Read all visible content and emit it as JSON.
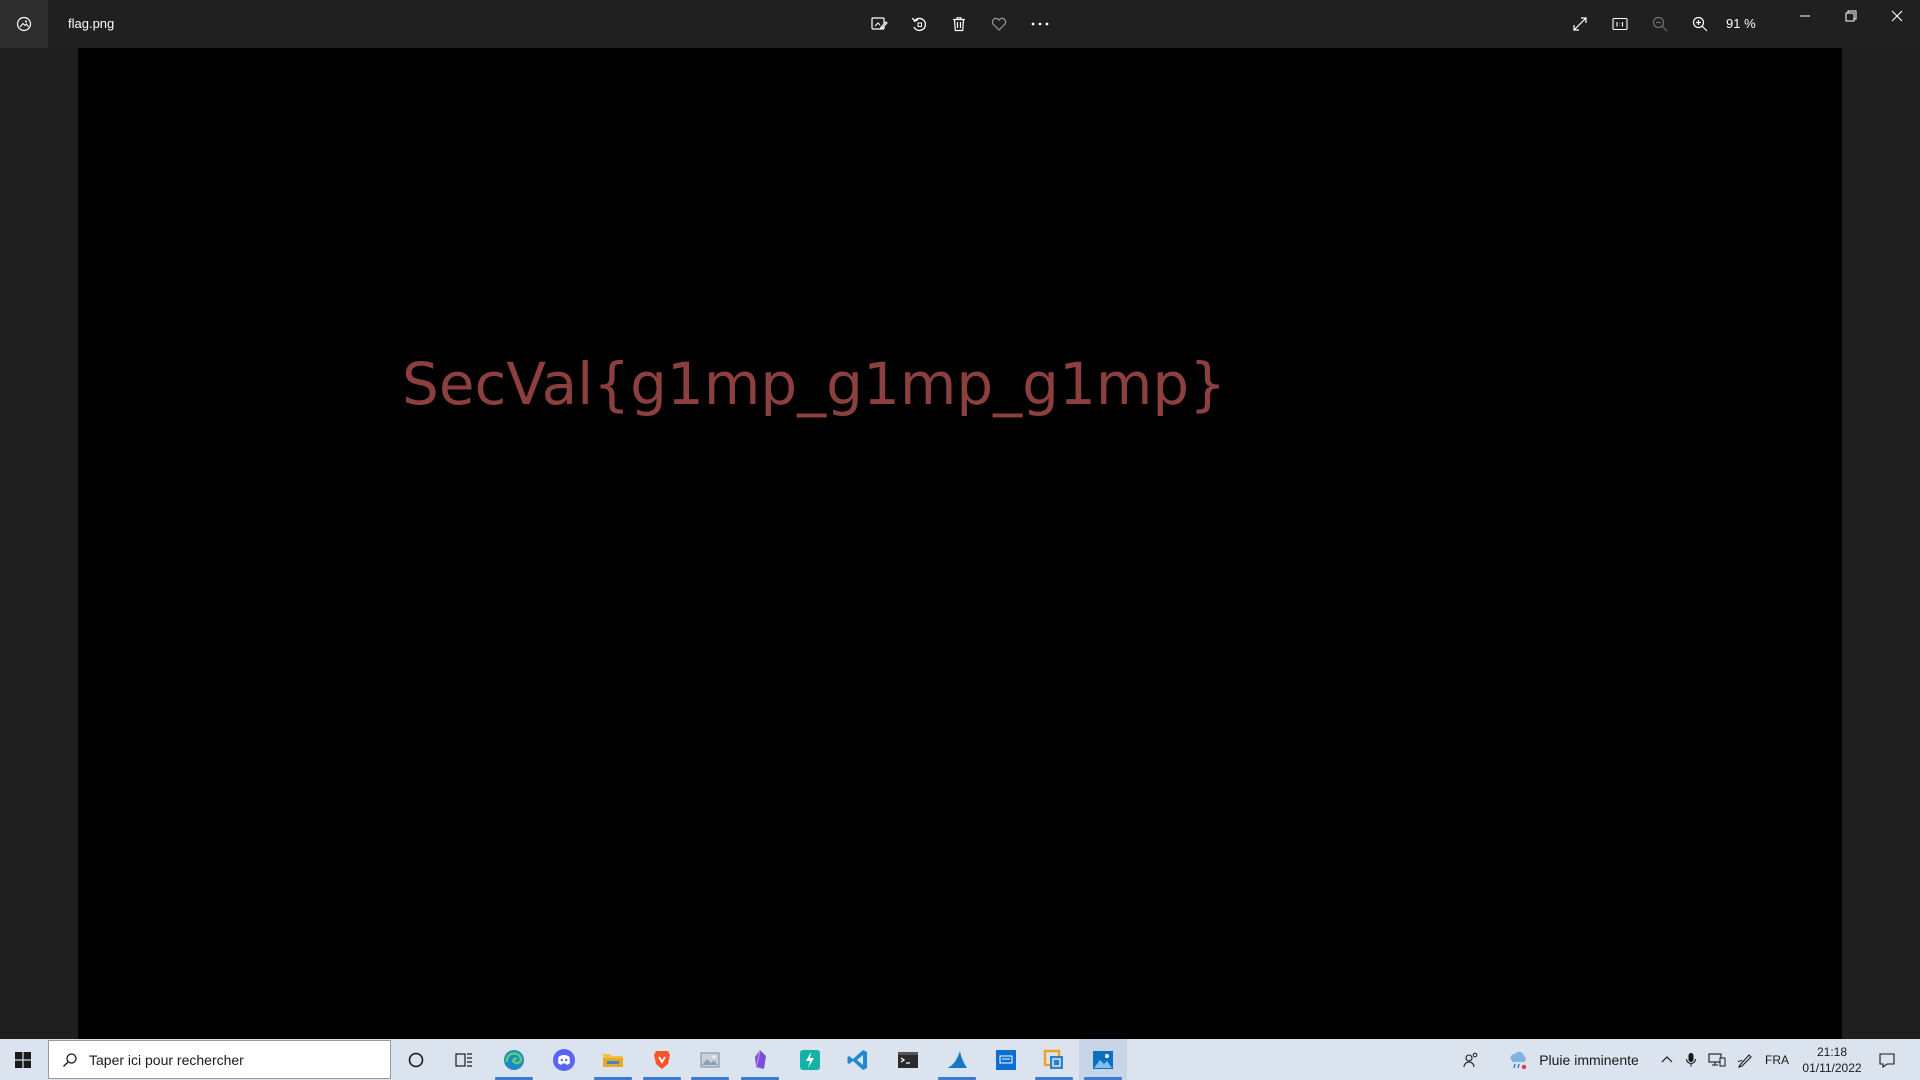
{
  "window": {
    "file_name": "flag.png",
    "zoom_label": "91 %"
  },
  "image": {
    "text": "SecVal{g1mp_g1mp_g1mp}"
  },
  "taskbar": {
    "search_placeholder": "Taper ici pour rechercher",
    "weather": "Pluie imminente",
    "language": "FRA",
    "time": "21:18",
    "date": "01/11/2022"
  },
  "colors": {
    "flag_text": "#8b3f3f",
    "titlebar_bg": "#202020",
    "taskbar_bg": "#dbe3ee"
  }
}
